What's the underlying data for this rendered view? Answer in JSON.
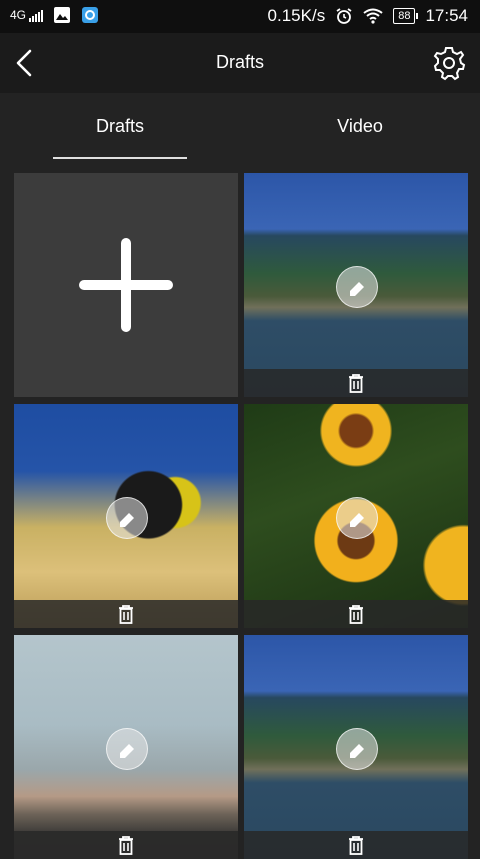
{
  "status_bar": {
    "network": "4G",
    "speed": "0.15K/s",
    "battery": "88",
    "time": "17:54",
    "icons": [
      "signal-icon",
      "gallery-icon",
      "app-notification-icon",
      "alarm-icon",
      "wifi-icon",
      "battery-icon"
    ]
  },
  "header": {
    "title": "Drafts",
    "back_icon": "back-arrow-icon",
    "settings_icon": "gear-icon"
  },
  "tabs": [
    {
      "label": "Drafts",
      "active": true
    },
    {
      "label": "Video",
      "active": false
    }
  ],
  "grid": {
    "new_tile_icon": "plus-icon",
    "items": [
      {
        "thumbnail": "boat",
        "edit_icon": "eraser-icon",
        "delete_icon": "trash-icon"
      },
      {
        "thumbnail": "fish",
        "edit_icon": "eraser-icon",
        "delete_icon": "trash-icon"
      },
      {
        "thumbnail": "flowers",
        "edit_icon": "eraser-icon",
        "delete_icon": "trash-icon"
      },
      {
        "thumbnail": "sunset",
        "edit_icon": "eraser-icon",
        "delete_icon": "trash-icon"
      },
      {
        "thumbnail": "boat",
        "edit_icon": "eraser-icon",
        "delete_icon": "trash-icon"
      }
    ]
  },
  "colors": {
    "background": "#232323",
    "header": "#1b1b1b",
    "status_bar": "#0f0f0f",
    "new_tile": "#3c3c3c",
    "text": "#ffffff"
  }
}
